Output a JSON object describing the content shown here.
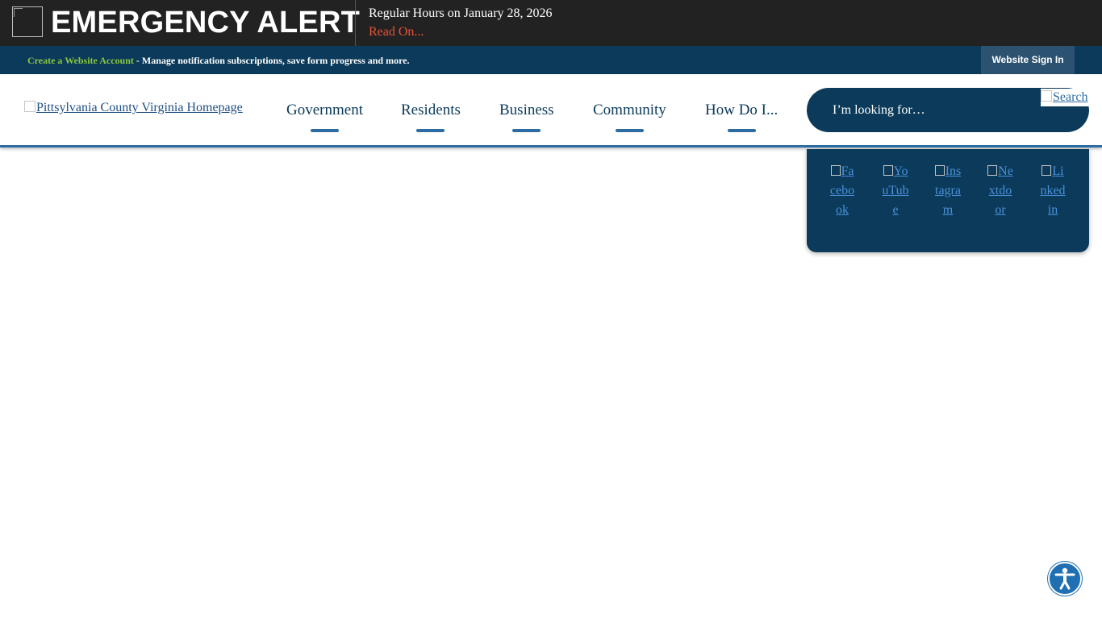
{
  "alert": {
    "title": "EMERGENCY ALERT",
    "message": "Regular Hours on January 28, 2026",
    "link_label": "Read On..."
  },
  "account_bar": {
    "create_label": "Create a Website Account",
    "description": " - Manage notification subscriptions, save form progress and more.",
    "signin_label": "Website Sign In"
  },
  "header": {
    "logo_alt": "Pittsylvania County Virginia Homepage",
    "nav": [
      {
        "label": "Government"
      },
      {
        "label": "Residents"
      },
      {
        "label": "Business"
      },
      {
        "label": "Community"
      },
      {
        "label": "How Do I..."
      }
    ]
  },
  "search": {
    "placeholder": "I’m looking for…",
    "button_alt": "Search"
  },
  "social": {
    "links": [
      {
        "label": "Facebook",
        "icon": "facebook-icon"
      },
      {
        "label": "YouTube",
        "icon": "youtube-icon"
      },
      {
        "label": "Instagram",
        "icon": "instagram-icon"
      },
      {
        "label": "Nextdoor",
        "icon": "nextdoor-icon"
      },
      {
        "label": "Linkedin",
        "icon": "linkedin-icon"
      }
    ]
  },
  "colors": {
    "alert_bg": "#222222",
    "brand_navy": "#0b3a5a",
    "accent_blue": "#2d6ca2",
    "account_link_green": "#8cc63e",
    "alert_link_red": "#e8533b"
  },
  "icons": {
    "alert": "alert-icon",
    "accessibility": "accessibility-icon"
  }
}
